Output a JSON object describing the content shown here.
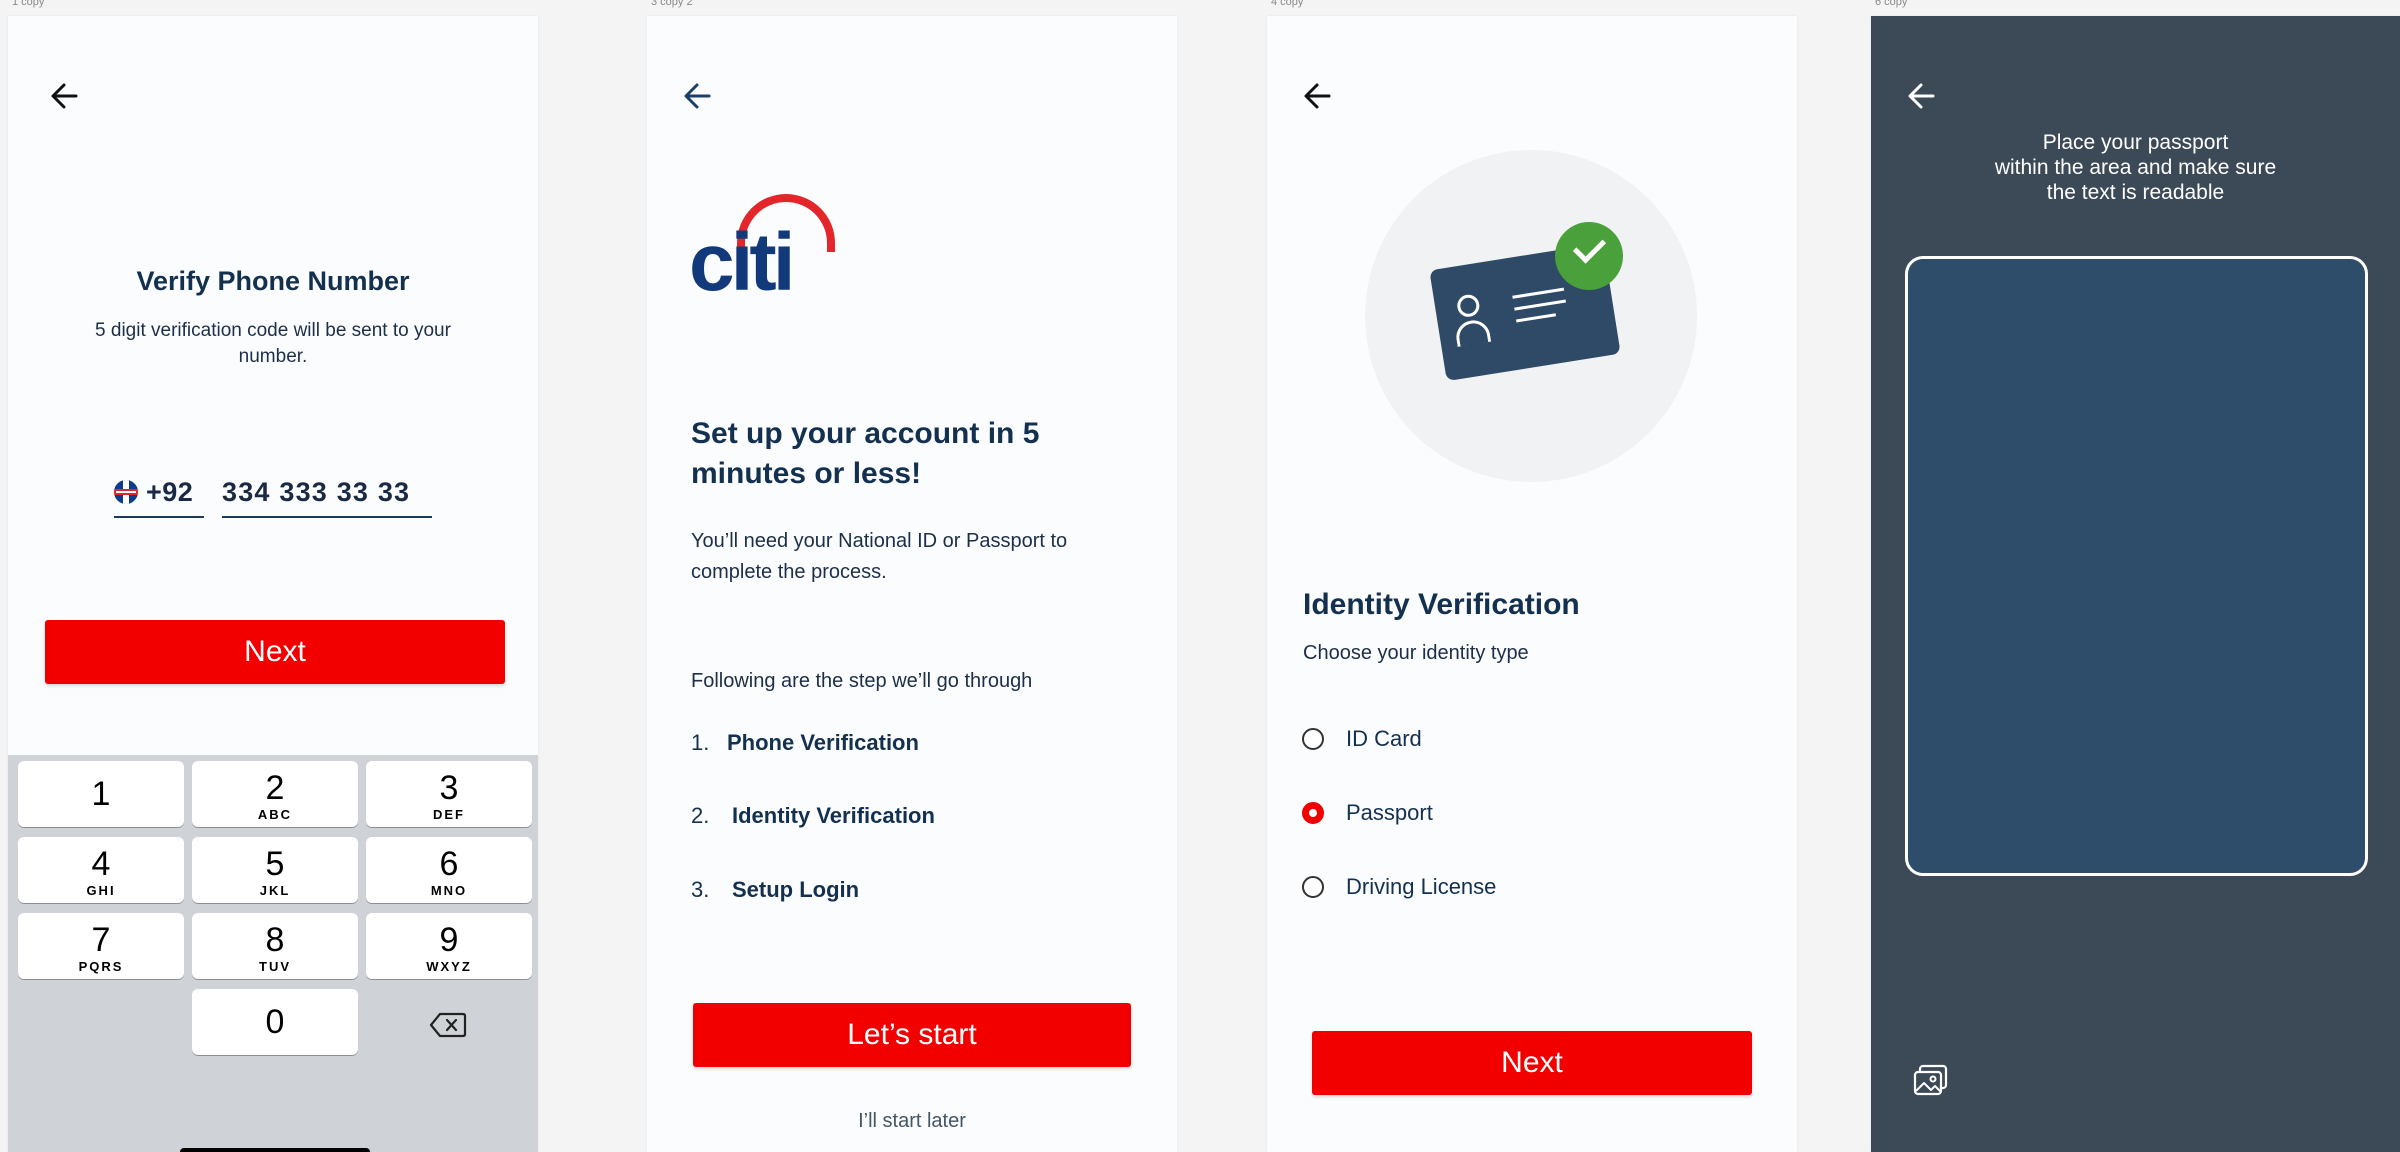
{
  "frames": [
    {
      "label": "1 copy"
    },
    {
      "label": "3 copy 2"
    },
    {
      "label": "4 copy"
    },
    {
      "label": "6 copy"
    }
  ],
  "verify_phone": {
    "title": "Verify Phone Number",
    "subtitle": "5 digit verification code will be sent to your number.",
    "country_code": "+92",
    "phone_number": "334 333 33 33",
    "next_label": "Next",
    "keypad": [
      {
        "num": "1",
        "letters": ""
      },
      {
        "num": "2",
        "letters": "ABC"
      },
      {
        "num": "3",
        "letters": "DEF"
      },
      {
        "num": "4",
        "letters": "GHI"
      },
      {
        "num": "5",
        "letters": "JKL"
      },
      {
        "num": "6",
        "letters": "MNO"
      },
      {
        "num": "7",
        "letters": "PQRS"
      },
      {
        "num": "8",
        "letters": "TUV"
      },
      {
        "num": "9",
        "letters": "WXYZ"
      },
      {
        "num": "0",
        "letters": ""
      }
    ]
  },
  "setup": {
    "logo_text": "citi",
    "headline": "Set up your account in 5 minutes or less!",
    "description": "You’ll need your National ID or Passport to complete the process.",
    "following": "Following are the step we’ll go through",
    "steps": [
      {
        "index": "1.",
        "label": "Phone Verification"
      },
      {
        "index": "2.",
        "label": "Identity Verification"
      },
      {
        "index": "3.",
        "label": "Setup Login"
      }
    ],
    "start_label": "Let’s start",
    "later_label": "I’ll start later"
  },
  "identity": {
    "title": "Identity Verification",
    "subtitle": "Choose your identity type",
    "options": [
      {
        "label": "ID Card",
        "selected": false
      },
      {
        "label": "Passport",
        "selected": true
      },
      {
        "label": "Driving License",
        "selected": false
      }
    ],
    "next_label": "Next"
  },
  "passport_scan": {
    "instruction": "Place your passport\nwithin the area and make sure\nthe text is readable"
  },
  "colors": {
    "accent_red": "#f20000",
    "navy_text": "#14304f",
    "scan_bg": "#3c4a57",
    "scan_area": "#2d4d6a",
    "success_green": "#4aa03a"
  },
  "icons": [
    "back-arrow-icon",
    "uk-flag-icon",
    "backspace-icon",
    "id-card-icon",
    "checkmark-icon",
    "gallery-icon"
  ]
}
